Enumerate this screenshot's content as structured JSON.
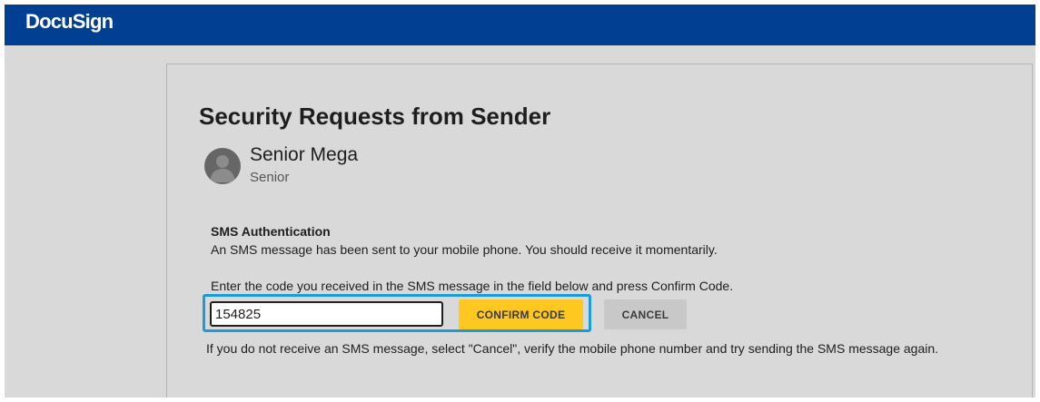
{
  "header": {
    "logo_text": "DocuSign",
    "background_color": "#003f91"
  },
  "page": {
    "title": "Security Requests from Sender"
  },
  "sender": {
    "name": "Senior Mega",
    "company": "Senior",
    "avatar_icon": "user-silhouette-icon"
  },
  "sms": {
    "heading": "SMS Authentication",
    "message": "An SMS message has been sent to your mobile phone. You should receive it momentarily.",
    "instruction": "Enter the code you received in the SMS message in the field below and press Confirm Code.",
    "code_value": "154825",
    "confirm_label": "CONFIRM CODE",
    "cancel_label": "CANCEL",
    "help_text": "If you do not receive an SMS message, select \"Cancel\", verify the mobile phone number and try sending the SMS message again."
  },
  "colors": {
    "confirm_button": "#ffc820",
    "focus_highlight": "#1a9cd8",
    "cancel_button": "#c8c8c8"
  }
}
